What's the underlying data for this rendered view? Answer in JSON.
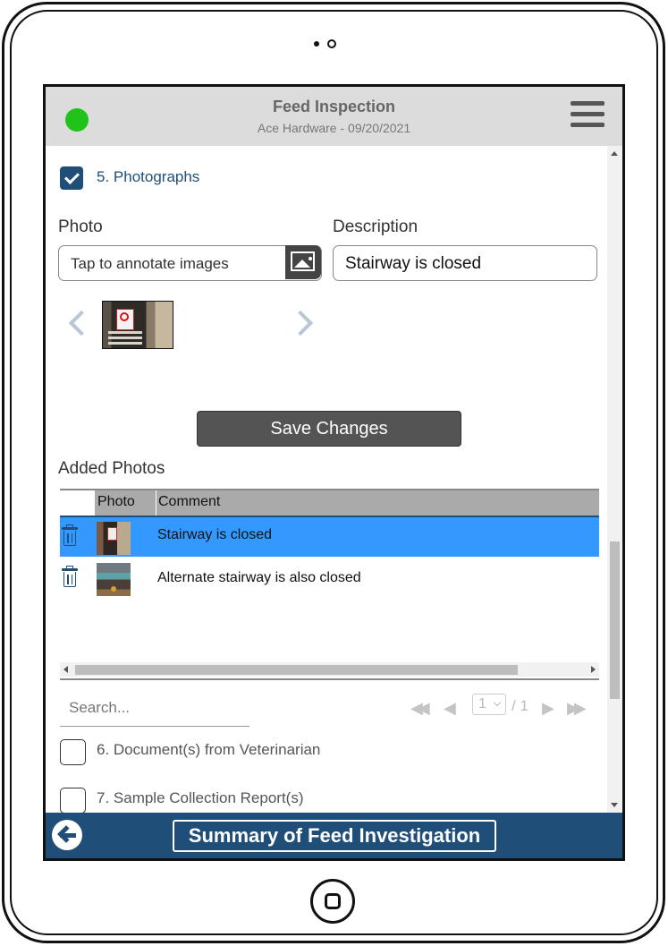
{
  "header": {
    "title": "Feed Inspection",
    "subtitle": "Ace Hardware - 09/20/2021",
    "status_color": "#21c21a"
  },
  "sections": [
    {
      "label": "5. Photographs",
      "checked": true
    },
    {
      "label": "6. Document(s) from Veterinarian",
      "checked": false
    },
    {
      "label": "7. Sample Collection Report(s)",
      "checked": false
    }
  ],
  "photo_form": {
    "photo_label": "Photo",
    "photo_input_text": "Tap to annotate images",
    "description_label": "Description",
    "description_value": "Stairway is closed",
    "save_label": "Save Changes"
  },
  "added_photos": {
    "heading": "Added Photos",
    "columns": [
      "Photo",
      "Comment"
    ],
    "rows": [
      {
        "comment": "Stairway is closed",
        "selected": true
      },
      {
        "comment": "Alternate stairway is also closed",
        "selected": false
      }
    ]
  },
  "search": {
    "placeholder": "Search..."
  },
  "pager": {
    "current": "1",
    "total_text": "/ 1"
  },
  "footer": {
    "title": "Summary of Feed Investigation"
  },
  "colors": {
    "accent": "#1f4e79",
    "selected_row": "#3399ff"
  },
  "icons": [
    "menu-icon",
    "image-icon",
    "chevron-left-icon",
    "chevron-right-icon",
    "trash-icon",
    "first-page-icon",
    "prev-page-icon",
    "next-page-icon",
    "last-page-icon",
    "back-arrow-icon"
  ]
}
